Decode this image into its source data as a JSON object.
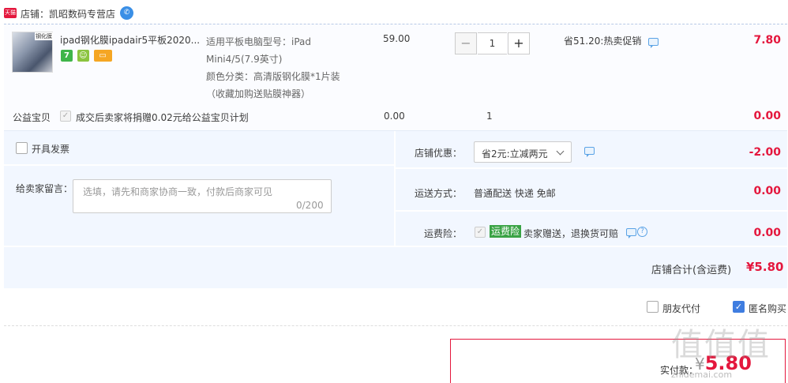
{
  "shop": {
    "badge": "天猫",
    "label": "店铺：凯昭数码专营店"
  },
  "item": {
    "thumb_tag": "钢化膜",
    "title": "ipad钢化膜ipadair5平板2020...",
    "service_icons": [
      "7",
      "",
      ""
    ],
    "sku_model": "适用平板电脑型号：iPad Mini4/5(7.9英寸)",
    "sku_color": "颜色分类：高清版钢化膜*1片装",
    "sku_note": "（收藏加购送贴膜神器）",
    "price": "59.00",
    "qty": "1",
    "qty_minus": "−",
    "qty_plus": "+",
    "promo": "省51.20:热卖促销",
    "total": "7.80"
  },
  "charity": {
    "label": "公益宝贝",
    "text": "成交后卖家将捐赠0.02元给公益宝贝计划",
    "price": "0.00",
    "qty": "1",
    "total": "0.00"
  },
  "invoice": {
    "label": "开具发票"
  },
  "message": {
    "label": "给卖家留言：",
    "placeholder": "选填，请先和商家协商一致，付款后商家可见",
    "count": "0/200"
  },
  "discount": {
    "label": "店铺优惠：",
    "selected": "省2元:立减两元",
    "amount": "-2.00"
  },
  "shipping": {
    "label": "运送方式：",
    "value": "普通配送 快递 免邮",
    "amount": "0.00"
  },
  "insurance": {
    "label": "运费险：",
    "tag": "运费险",
    "text": "卖家赠送，退换货可赔",
    "amount": "0.00"
  },
  "shop_total": {
    "label": "店铺合计(含运费)",
    "value": "¥5.80"
  },
  "options": {
    "friend_pay": "朋友代付",
    "anonymous": "匿名购买"
  },
  "final": {
    "label": "实付款：",
    "yen": "¥",
    "value": "5.80"
  },
  "watermark": {
    "mark": "值值值",
    "sub": "zhidemai.com"
  },
  "colors": {
    "accent": "#e4173d",
    "panel_bg": "#f2f7ff",
    "checkbox_blue": "#3f7de0",
    "insurance_green": "#3aa345"
  }
}
